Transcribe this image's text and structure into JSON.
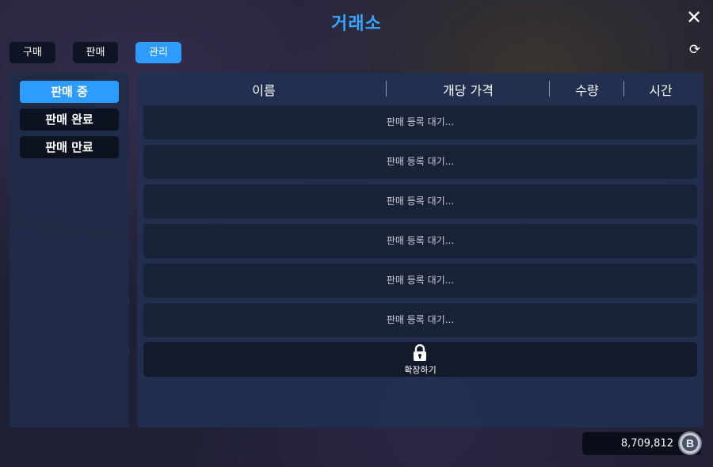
{
  "title": "거래소",
  "icons": {
    "close": "close-icon",
    "refresh": "refresh-icon",
    "lock": "lock-icon",
    "coin": "coin-icon"
  },
  "tabs": [
    {
      "label": "구매",
      "active": false
    },
    {
      "label": "판매",
      "active": false
    },
    {
      "label": "관리",
      "active": true
    }
  ],
  "side_menu": [
    {
      "label": "판매 중",
      "active": true
    },
    {
      "label": "판매 완료",
      "active": false
    },
    {
      "label": "판매 만료",
      "active": false
    }
  ],
  "table": {
    "headers": [
      "이름",
      "개당 가격",
      "수량",
      "시간"
    ],
    "rows": [
      "판매 등록 대기...",
      "판매 등록 대기...",
      "판매 등록 대기...",
      "판매 등록 대기...",
      "판매 등록 대기...",
      "판매 등록 대기..."
    ],
    "expand_label": "확장하기"
  },
  "currency": {
    "amount": "8,709,812",
    "coin_letter": "B"
  },
  "colors": {
    "accent": "#2e9cff",
    "title": "#36a6ff",
    "panel": "#223050",
    "row": "#1a2238"
  }
}
